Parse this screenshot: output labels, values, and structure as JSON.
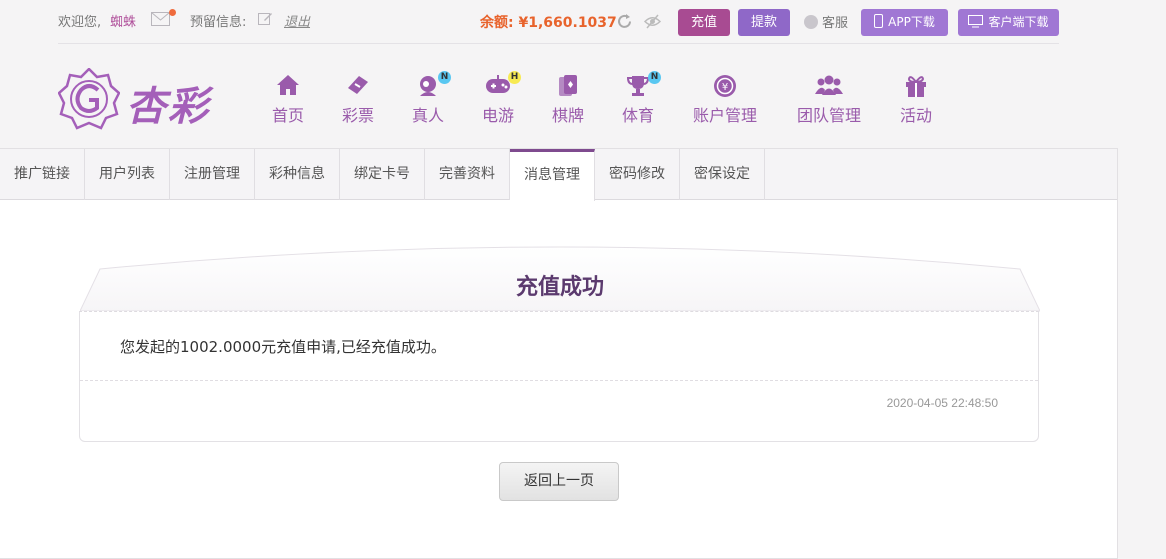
{
  "topbar": {
    "welcome": "欢迎您,",
    "username": "蜘蛛",
    "reserve_info": "预留信息:",
    "logout": "退出",
    "balance": "余额: ¥1,660.1037",
    "recharge": "充值",
    "withdraw": "提款",
    "service": "客服",
    "app_download": "APP下载",
    "client_download": "客户端下载"
  },
  "logo": {
    "text": "杏彩"
  },
  "nav": [
    {
      "label": "首页",
      "icon": "home-icon"
    },
    {
      "label": "彩票",
      "icon": "lottery-icon"
    },
    {
      "label": "真人",
      "icon": "live-dealer-icon",
      "tag": "N"
    },
    {
      "label": "电游",
      "icon": "gamepad-icon",
      "tag": "H"
    },
    {
      "label": "棋牌",
      "icon": "cards-icon"
    },
    {
      "label": "体育",
      "icon": "trophy-icon",
      "tag": "N"
    },
    {
      "label": "账户管理",
      "icon": "account-icon"
    },
    {
      "label": "团队管理",
      "icon": "team-icon"
    },
    {
      "label": "活动",
      "icon": "gift-icon"
    }
  ],
  "tabs": [
    "推广链接",
    "用户列表",
    "注册管理",
    "彩种信息",
    "绑定卡号",
    "完善资料",
    "消息管理",
    "密码修改",
    "密保设定"
  ],
  "active_tab": "消息管理",
  "message": {
    "title": "充值成功",
    "content": "您发起的1002.0000元充值申请,已经充值成功。",
    "time": "2020-04-05 22:48:50"
  },
  "back_button": "返回上一页",
  "colors": {
    "brand_purple": "#9a5bab",
    "recharge": "#a84b92",
    "withdraw": "#8f68c8",
    "balance": "#e8632c"
  }
}
